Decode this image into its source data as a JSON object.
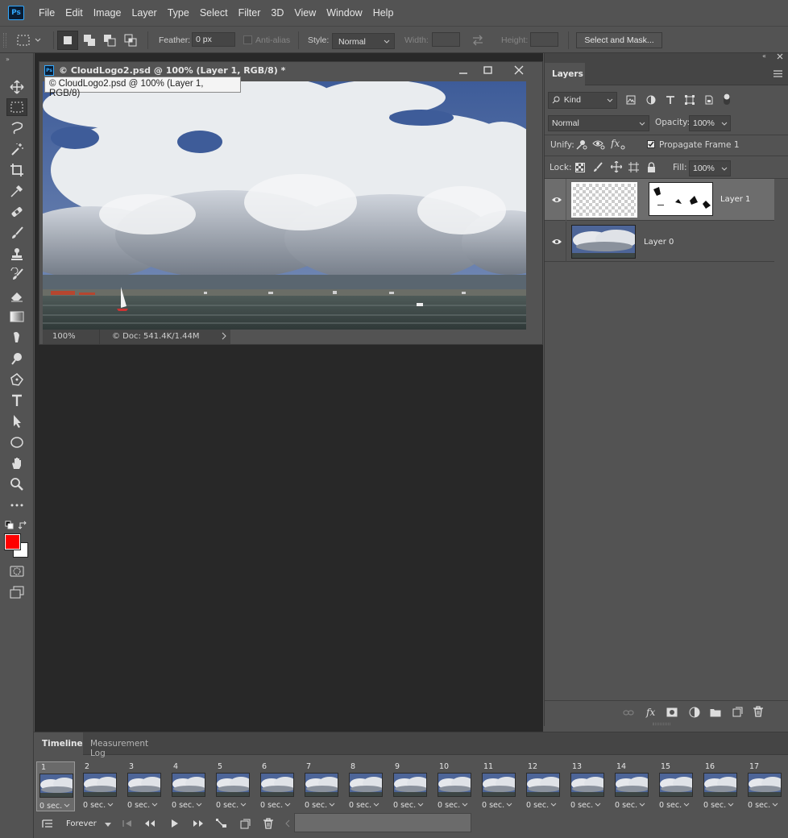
{
  "app": {
    "logo": "Ps"
  },
  "menu": [
    "File",
    "Edit",
    "Image",
    "Layer",
    "Type",
    "Select",
    "Filter",
    "3D",
    "View",
    "Window",
    "Help"
  ],
  "options": {
    "feather_label": "Feather:",
    "feather_value": "0 px",
    "antialias_label": "Anti-alias",
    "style_label": "Style:",
    "style_value": "Normal",
    "width_label": "Width:",
    "height_label": "Height:",
    "select_mask_label": "Select and Mask..."
  },
  "document": {
    "title": "© CloudLogo2.psd @ 100% (Layer 1, RGB/8) *",
    "tooltip": "© CloudLogo2.psd @ 100% (Layer 1, RGB/8)",
    "zoom": "100%",
    "doc_info": "© Doc: 541.4K/1.44M"
  },
  "layers_panel": {
    "tab": "Layers",
    "filter_kind": "Kind",
    "blend_mode": "Normal",
    "opacity_label": "Opacity:",
    "opacity_value": "100%",
    "unify_label": "Unify:",
    "propagate_label": "Propagate Frame 1",
    "propagate_checked": true,
    "lock_label": "Lock:",
    "fill_label": "Fill:",
    "fill_value": "100%",
    "layers": [
      {
        "name": "Layer 1",
        "visible": true,
        "selected": true
      },
      {
        "name": "Layer 0",
        "visible": true,
        "selected": false
      }
    ]
  },
  "timeline": {
    "tabs": [
      "Timeline",
      "Measurement Log"
    ],
    "active_tab": "Timeline",
    "frames": [
      {
        "num": "1",
        "delay": "0 sec."
      },
      {
        "num": "2",
        "delay": "0 sec."
      },
      {
        "num": "3",
        "delay": "0 sec."
      },
      {
        "num": "4",
        "delay": "0 sec."
      },
      {
        "num": "5",
        "delay": "0 sec."
      },
      {
        "num": "6",
        "delay": "0 sec."
      },
      {
        "num": "7",
        "delay": "0 sec."
      },
      {
        "num": "8",
        "delay": "0 sec."
      },
      {
        "num": "9",
        "delay": "0 sec."
      },
      {
        "num": "10",
        "delay": "0 sec."
      },
      {
        "num": "11",
        "delay": "0 sec."
      },
      {
        "num": "12",
        "delay": "0 sec."
      },
      {
        "num": "13",
        "delay": "0 sec."
      },
      {
        "num": "14",
        "delay": "0 sec."
      },
      {
        "num": "15",
        "delay": "0 sec."
      },
      {
        "num": "16",
        "delay": "0 sec."
      },
      {
        "num": "17",
        "delay": "0 sec."
      }
    ],
    "selected_frame": "1",
    "loop": "Forever"
  },
  "colors": {
    "foreground": "#ff0000",
    "background": "#ffffff",
    "accent": "#31a8ff"
  }
}
